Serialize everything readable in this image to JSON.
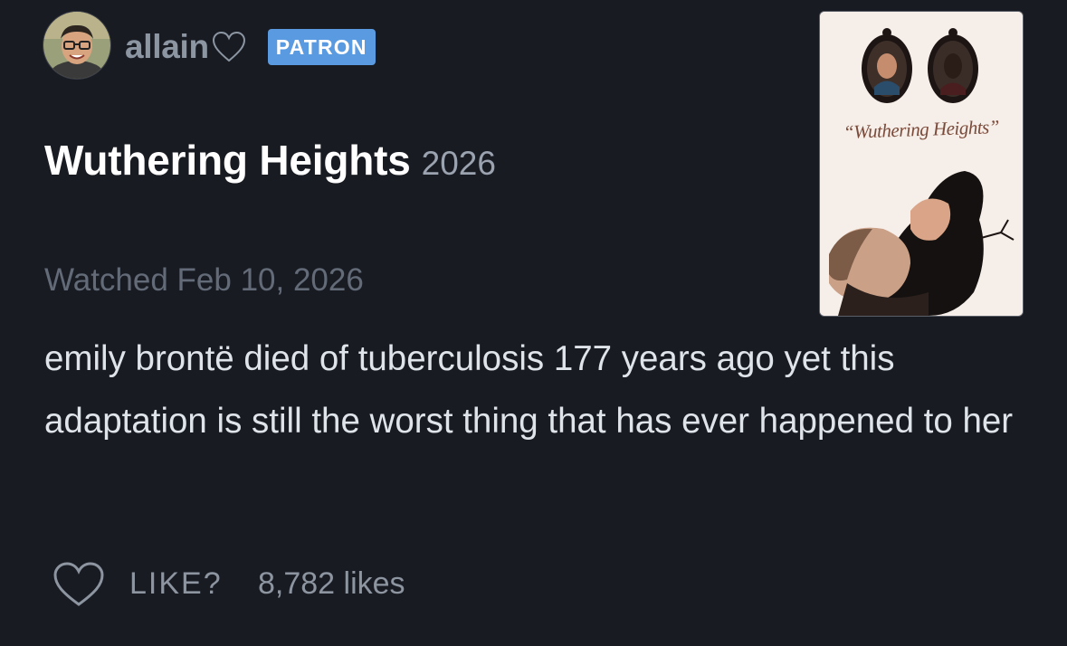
{
  "user": {
    "name": "allain",
    "badge": "PATRON"
  },
  "film": {
    "title": "Wuthering Heights",
    "year": "2026",
    "poster_title": "“Wuthering Heights”"
  },
  "watched": "Watched Feb 10, 2026",
  "review": {
    "text": "emily brontë died of tuberculosis 177 years ago yet this adaptation is still the worst thing that has ever happened to her"
  },
  "actions": {
    "like_label": "LIKE?",
    "likes_count": "8,782 likes"
  },
  "icons": {
    "name_heart": "heart-outline-icon",
    "like": "heart-outline-icon"
  },
  "colors": {
    "background": "#191b22",
    "patron_badge": "#5a9ae0",
    "muted_text": "#8d95a1"
  }
}
